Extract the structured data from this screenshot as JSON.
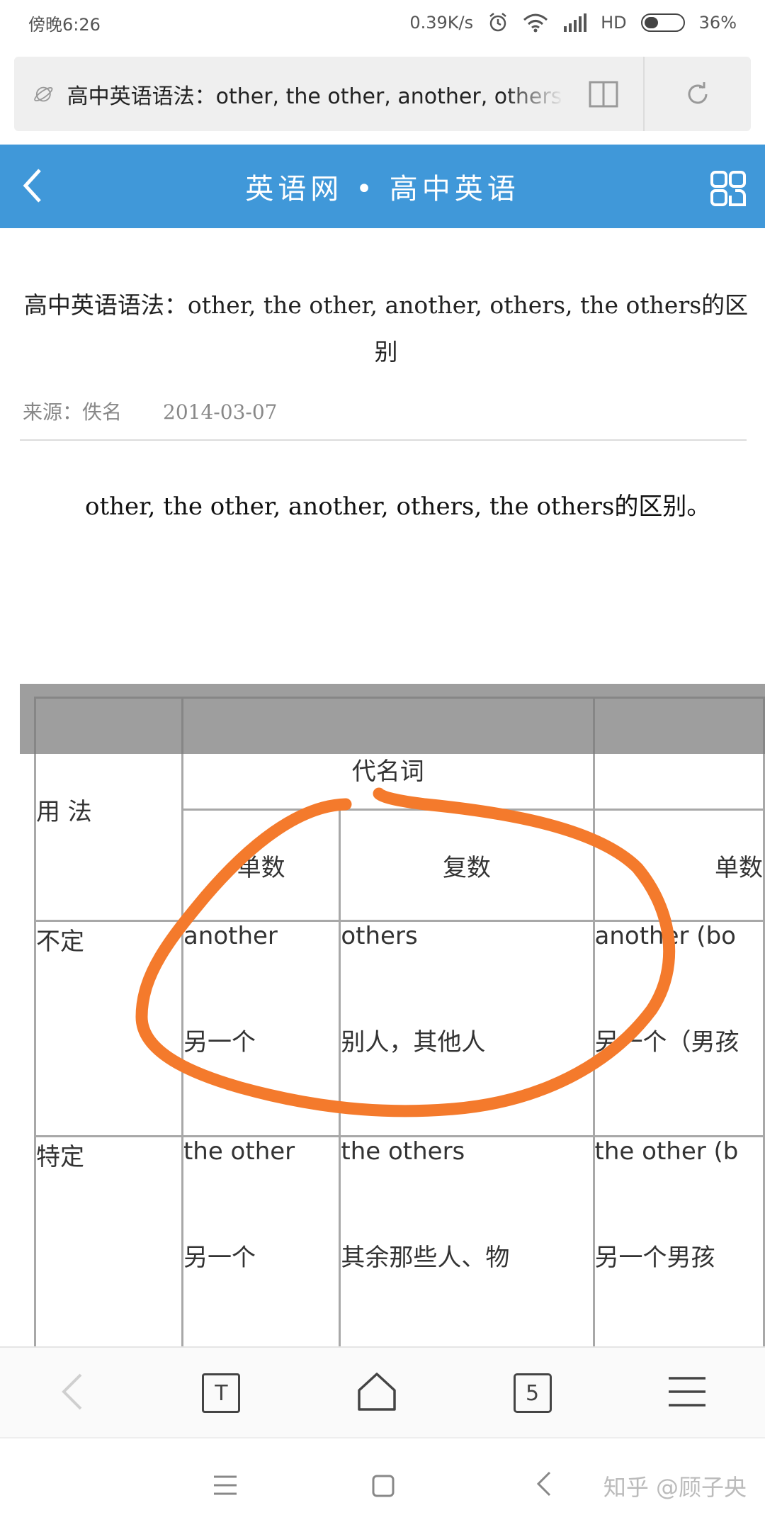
{
  "status_bar": {
    "time": "傍晚6:26",
    "network_speed": "0.39K/s",
    "hd": "HD",
    "battery": "36%",
    "battery_level": 0.36
  },
  "browser": {
    "tab_title": "高中英语语法：other, the other, another, others, the others的区别"
  },
  "site": {
    "name": "英语网",
    "separator": "•",
    "section": "高中英语"
  },
  "article": {
    "title": "高中英语语法：other, the other, another, others, the others的区别",
    "source_label": "来源：",
    "source": "佚名",
    "date": "2014-03-07",
    "intro": "other, the other, another, others, the others的区别。"
  },
  "table": {
    "header_pronoun": "代名词",
    "usage_label": "用 法",
    "singular": "单数",
    "plural": "复数",
    "singular_partial": "单数",
    "rows": [
      {
        "label": "不定",
        "singular_word": "another",
        "singular_meaning": "另一个",
        "plural_word": "others",
        "plural_meaning": "别人，其他人",
        "extra_word": "another (bo",
        "extra_meaning": "另一个（男孩"
      },
      {
        "label": "特定",
        "singular_word": "the other",
        "singular_meaning": "另一个",
        "plural_word": "the others",
        "plural_meaning": "其余那些人、物",
        "extra_word": "the other (b",
        "extra_meaning": "另一个男孩"
      }
    ],
    "annotation_color": "#f47a2c"
  },
  "toolbar": {
    "tab_count": "5",
    "text_mode": "T"
  },
  "watermark": "知乎 @顾子央",
  "colors": {
    "header_blue": "#4098d9"
  }
}
